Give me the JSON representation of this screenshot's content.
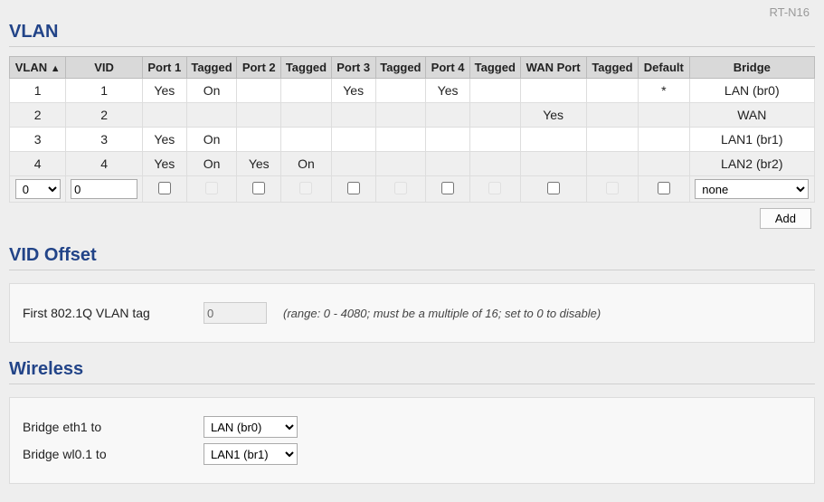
{
  "model": "RT-N16",
  "sections": {
    "vlan": "VLAN",
    "offset": "VID Offset",
    "wireless": "Wireless"
  },
  "table": {
    "headers": {
      "vlan": "VLAN",
      "sort": "▲",
      "vid": "VID",
      "port1": "Port 1",
      "tag1": "Tagged",
      "port2": "Port 2",
      "tag2": "Tagged",
      "port3": "Port 3",
      "tag3": "Tagged",
      "port4": "Port 4",
      "tag4": "Tagged",
      "wan": "WAN Port",
      "wantag": "Tagged",
      "def": "Default",
      "bridge": "Bridge"
    },
    "rows": [
      {
        "vlan": "1",
        "vid": "1",
        "port1": "Yes",
        "tag1": "On",
        "port2": "",
        "tag2": "",
        "port3": "Yes",
        "tag3": "",
        "port4": "Yes",
        "tag4": "",
        "wan": "",
        "wantag": "",
        "def": "*",
        "bridge": "LAN (br0)"
      },
      {
        "vlan": "2",
        "vid": "2",
        "port1": "",
        "tag1": "",
        "port2": "",
        "tag2": "",
        "port3": "",
        "tag3": "",
        "port4": "",
        "tag4": "",
        "wan": "Yes",
        "wantag": "",
        "def": "",
        "bridge": "WAN"
      },
      {
        "vlan": "3",
        "vid": "3",
        "port1": "Yes",
        "tag1": "On",
        "port2": "",
        "tag2": "",
        "port3": "",
        "tag3": "",
        "port4": "",
        "tag4": "",
        "wan": "",
        "wantag": "",
        "def": "",
        "bridge": "LAN1 (br1)"
      },
      {
        "vlan": "4",
        "vid": "4",
        "port1": "Yes",
        "tag1": "On",
        "port2": "Yes",
        "tag2": "On",
        "port3": "",
        "tag3": "",
        "port4": "",
        "tag4": "",
        "wan": "",
        "wantag": "",
        "def": "",
        "bridge": "LAN2 (br2)"
      }
    ],
    "input": {
      "vlan_sel": "0",
      "vid": "0",
      "bridge_sel": "none"
    },
    "add_label": "Add"
  },
  "offset": {
    "label": "First 802.1Q VLAN tag",
    "value": "0",
    "hint": "(range: 0 - 4080; must be a multiple of 16; set to 0 to disable)"
  },
  "wireless": {
    "rows": [
      {
        "label": "Bridge eth1 to",
        "value": "LAN (br0)"
      },
      {
        "label": "Bridge wl0.1 to",
        "value": "LAN1 (br1)"
      }
    ]
  }
}
